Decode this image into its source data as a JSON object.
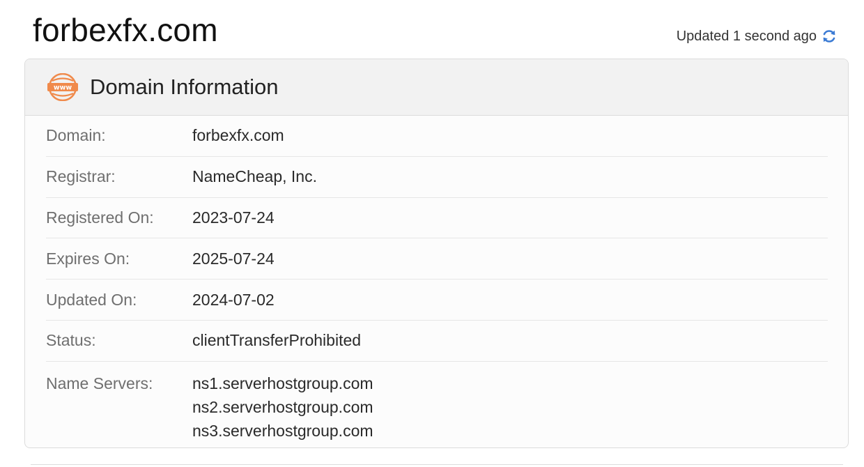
{
  "header": {
    "site_title": "forbexfx.com",
    "updated_text": "Updated 1 second ago",
    "refresh_icon": "refresh-icon"
  },
  "card": {
    "icon": "www-globe-icon",
    "title": "Domain Information",
    "rows": [
      {
        "label": "Domain:",
        "value": "forbexfx.com"
      },
      {
        "label": "Registrar:",
        "value": "NameCheap, Inc."
      },
      {
        "label": "Registered On:",
        "value": "2023-07-24"
      },
      {
        "label": "Expires On:",
        "value": "2025-07-24"
      },
      {
        "label": "Updated On:",
        "value": "2024-07-02"
      },
      {
        "label": "Status:",
        "value": "clientTransferProhibited"
      }
    ],
    "name_servers": {
      "label": "Name Servers:",
      "values": [
        "ns1.serverhostgroup.com",
        "ns2.serverhostgroup.com",
        "ns3.serverhostgroup.com"
      ]
    }
  },
  "colors": {
    "icon_orange": "#f08a4b",
    "refresh_blue": "#3b7bd4"
  }
}
